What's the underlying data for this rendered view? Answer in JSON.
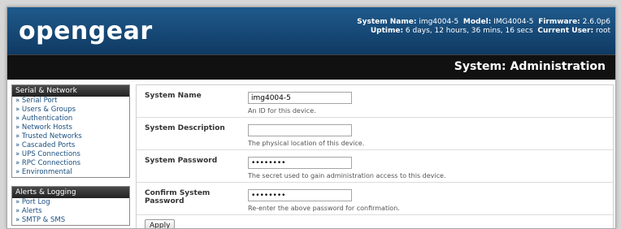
{
  "header": {
    "logo": "opengear",
    "system_name_label": "System Name:",
    "system_name": "img4004-5",
    "model_label": "Model:",
    "model": "IMG4004-5",
    "firmware_label": "Firmware:",
    "firmware": "2.6.0p6",
    "uptime_label": "Uptime:",
    "uptime": "6 days, 12 hours, 36 mins, 16 secs",
    "current_user_label": "Current User:",
    "current_user": "root"
  },
  "page_title": "System: Administration",
  "sidebar": {
    "groups": [
      {
        "title": "Serial & Network",
        "items": [
          "» Serial Port",
          "» Users & Groups",
          "» Authentication",
          "» Network Hosts",
          "» Trusted Networks",
          "» Cascaded Ports",
          "» UPS Connections",
          "» RPC Connections",
          "» Environmental"
        ]
      },
      {
        "title": "Alerts & Logging",
        "items": [
          "» Port Log",
          "» Alerts",
          "» SMTP & SMS"
        ]
      }
    ]
  },
  "form": {
    "fields": [
      {
        "label": "System Name",
        "value": "img4004-5",
        "help": "An ID for this device."
      },
      {
        "label": "System Description",
        "value": "",
        "help": "The physical location of this device."
      },
      {
        "label": "System Password",
        "value": "••••••••",
        "help": "The secret used to gain administration access to this device."
      },
      {
        "label": "Confirm System Password",
        "value": "••••••••",
        "help": "Re-enter the above password for confirmation."
      }
    ],
    "apply_label": "Apply"
  }
}
